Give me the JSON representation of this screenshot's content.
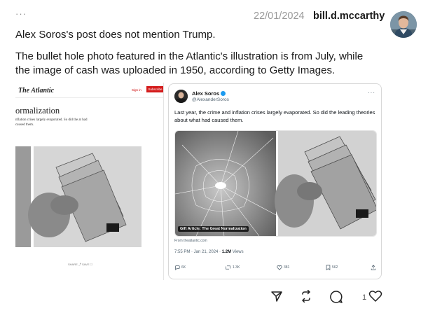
{
  "post": {
    "more_label": "···",
    "date": "22/01/2024",
    "username": "bill.d.mccarthy",
    "paragraphs": [
      "Alex Soros's post does not mention Trump.",
      "The bullet hole photo featured in the Atlantic's illustration is from July, while the image of cash was uploaded in 1950, according to Getty Images."
    ],
    "like_count": "1"
  },
  "atlantic_image": {
    "logo": "The Atlantic",
    "sign_in": "Sign in",
    "subscribe": "Subscribe",
    "headline": "ormalization",
    "deck": "nflation crises largely evaporated. So did the at had caused them.",
    "footer": "SHARE ⤴   SAVE ☐"
  },
  "tweet_image": {
    "name": "Alex Soros",
    "handle": "@AlexanderSoros",
    "text": "Last year, the crime and inflation crises largely evaporated. So did the leading theories about what had caused them.",
    "caption": "Gift Article: The Great Normalization",
    "from": "From theatlantic.com",
    "time": "7:55 PM · Jan 21, 2024 · ",
    "views": "1.2M",
    "views_label": " Views",
    "replies": "6K",
    "reposts": "1.3K",
    "likes": "381",
    "bookmarks": "562",
    "verified_color": "#1d9bf0"
  },
  "icons": [
    "more-icon",
    "share-icon",
    "repost-icon",
    "reply-icon",
    "like-icon"
  ]
}
